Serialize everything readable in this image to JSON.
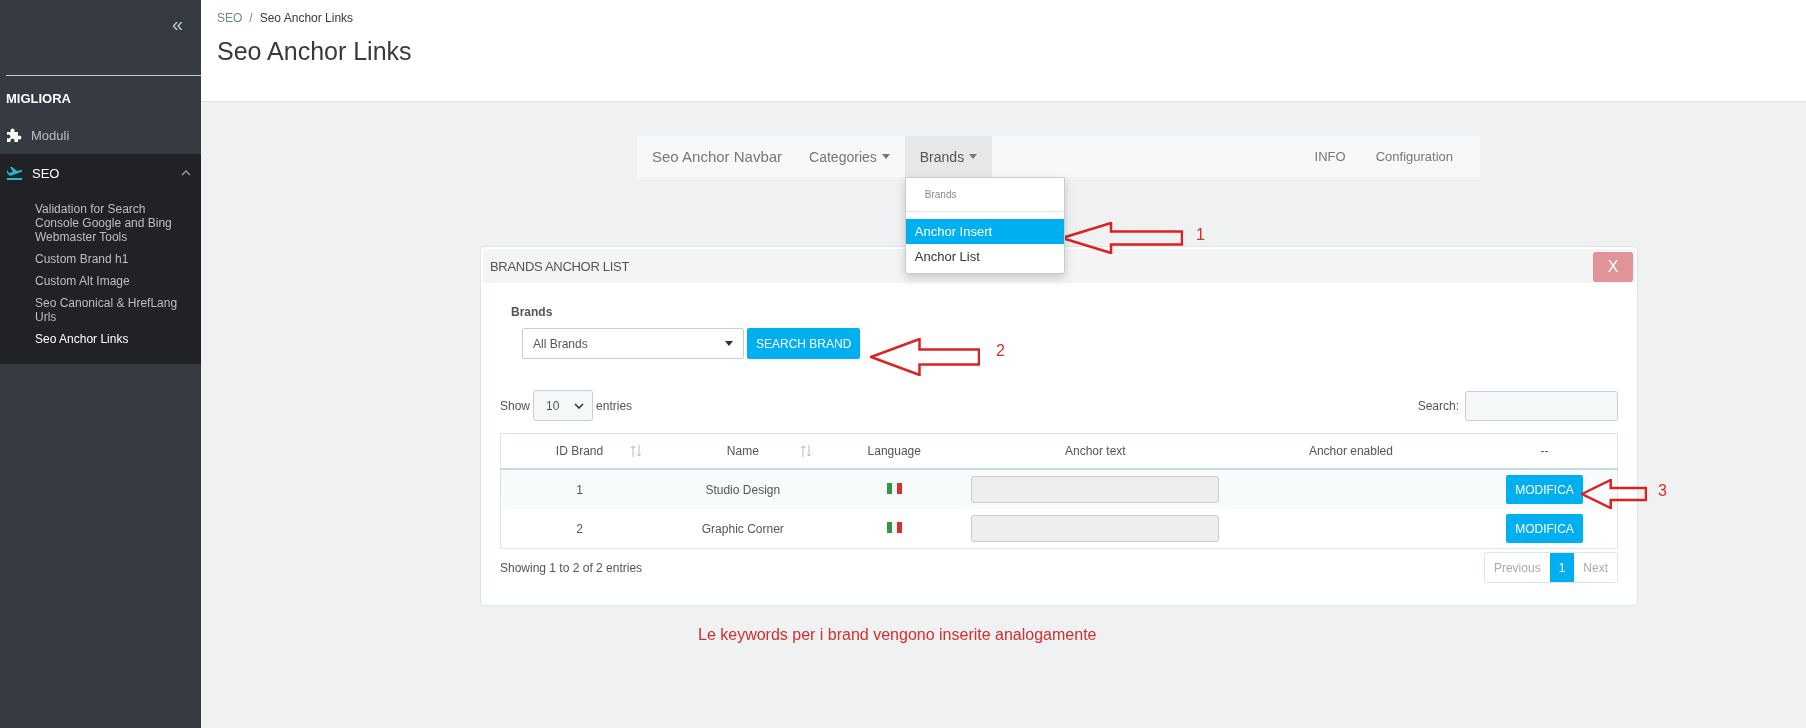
{
  "sidebar": {
    "collapse": "«",
    "section_title": "MIGLIORA",
    "items": [
      {
        "label": "Moduli",
        "selected": false
      },
      {
        "label": "SEO",
        "selected": true,
        "expanded": true,
        "children": [
          {
            "label": "Validation for Search Console Google and Bing Webmaster Tools",
            "selected": false
          },
          {
            "label": "Custom Brand h1",
            "selected": false
          },
          {
            "label": "Custom Alt Image",
            "selected": false
          },
          {
            "label": "Seo Canonical & HrefLang Urls",
            "selected": false
          },
          {
            "label": "Seo Anchor Links",
            "selected": true
          }
        ]
      }
    ]
  },
  "breadcrumb": [
    "SEO",
    "Seo Anchor Links"
  ],
  "breadcrumb_separator": "/",
  "page_title": "Seo Anchor Links",
  "navbar": {
    "items": [
      {
        "label": "Seo Anchor Navbar",
        "kind": "brand",
        "selected": false
      },
      {
        "label": "Categories",
        "kind": "dropdown",
        "selected": false
      },
      {
        "label": "Brands",
        "kind": "dropdown",
        "selected": true
      }
    ],
    "right_items": [
      "INFO",
      "Configuration"
    ],
    "dropdown": {
      "header": "Brands",
      "items": [
        {
          "label": "Anchor Insert",
          "selected": true
        },
        {
          "label": "Anchor List",
          "selected": false
        }
      ]
    }
  },
  "panel": {
    "title": "BRANDS ANCHOR LIST",
    "close": "X",
    "filter_label": "Brands",
    "filter_value": "All Brands",
    "search_button": "SEARCH BRAND",
    "show_label": "Show",
    "page_size": "10",
    "entries_label": "entries",
    "search_label": "Search:",
    "table": {
      "columns": [
        {
          "label": "ID Brand",
          "sortable": true
        },
        {
          "label": "Name",
          "sortable": true
        },
        {
          "label": "Language",
          "sortable": false
        },
        {
          "label": "Anchor text",
          "sortable": false
        },
        {
          "label": "Anchor enabled",
          "sortable": false
        },
        {
          "label": "--",
          "sortable": false
        }
      ],
      "rows": [
        {
          "id": "1",
          "name": "Studio Design",
          "action": "MODIFICA"
        },
        {
          "id": "2",
          "name": "Graphic Corner",
          "action": "MODIFICA"
        }
      ]
    },
    "info": "Showing 1 to 2 of 2 entries",
    "pagination": {
      "previous": {
        "label": "Previous",
        "disabled": true
      },
      "pages": [
        {
          "label": "1",
          "selected": true
        }
      ],
      "next": {
        "label": "Next",
        "disabled": true
      }
    }
  },
  "note": "Le keywords per i brand vengono inserite analogamente",
  "annotations": [
    "1",
    "2",
    "3"
  ]
}
